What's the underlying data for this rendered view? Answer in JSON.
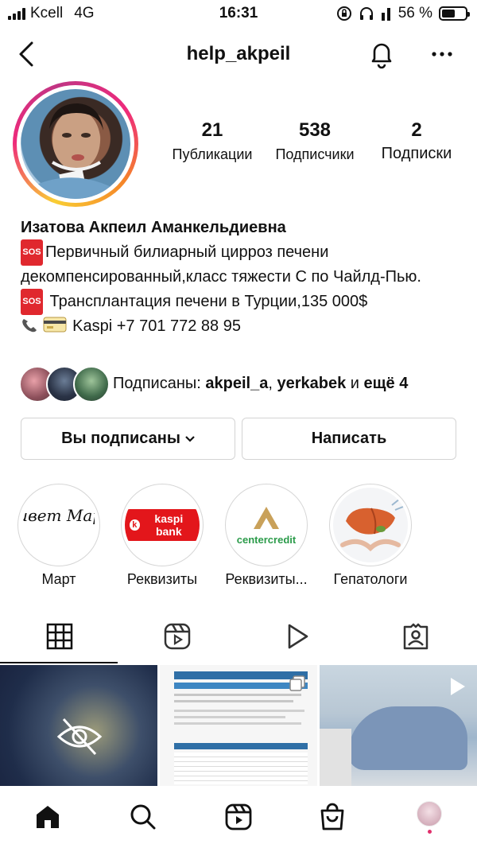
{
  "status_bar": {
    "carrier": "Kcell",
    "network": "4G",
    "time": "16:31",
    "battery": "56 %",
    "battery_level": 0.56
  },
  "header": {
    "username": "help_akpeil",
    "icons": [
      "back-arrow-icon",
      "bell-icon",
      "more-options-icon"
    ]
  },
  "stats": [
    {
      "value": "21",
      "label": "Публикации"
    },
    {
      "value": "538",
      "label": "Подписчики"
    },
    {
      "value": "2",
      "label": "Подписки"
    }
  ],
  "bio": {
    "name": "Изатова Акпеил Аманкельдиевна",
    "sos_badge": "SOS",
    "line1": "Первичный билиарный цирроз печени декомпенсированный,класс тяжести С по Чайлд-Пью.",
    "line2": " Трансплантация печени в Турции,135 000$",
    "line3": "Kaspi +7 701 772 88 95"
  },
  "followed_by": {
    "prefix": "Подписаны: ",
    "user1": "akpeil_a",
    "sep": ", ",
    "user2": "yerkabek",
    "mid": " и ",
    "more": "ещё 4"
  },
  "buttons": {
    "following": "Вы подписаны",
    "message": "Написать"
  },
  "highlights": [
    {
      "label": "Март",
      "cover_text": "Привет Март!"
    },
    {
      "label": "Реквизиты",
      "cover_text": "kaspi bank"
    },
    {
      "label": "Реквизиты...",
      "cover_text": "centercredit"
    },
    {
      "label": "Гепатологи",
      "cover_text": ""
    }
  ],
  "tabs": [
    "grid-icon",
    "reels-icon",
    "video-icon",
    "tagged-icon"
  ],
  "bottom_nav": [
    "home-icon",
    "search-icon",
    "reels-icon",
    "shop-icon",
    "profile-avatar"
  ],
  "colors": {
    "sos_red": "#e0282e",
    "kaspi_red": "#e3161b",
    "centercredit_green": "#2b9b4a"
  }
}
